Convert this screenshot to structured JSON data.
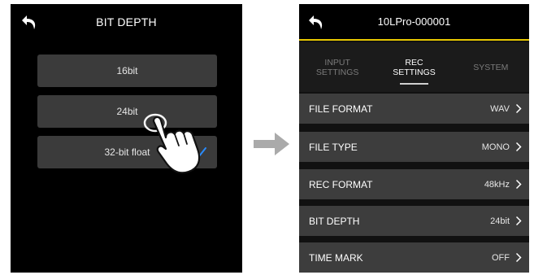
{
  "left_screen": {
    "title": "BIT DEPTH",
    "options": [
      {
        "label": "16bit"
      },
      {
        "label": "24bit"
      },
      {
        "label": "32-bit float"
      }
    ],
    "checked_option": "32-bit float"
  },
  "right_screen": {
    "title": "10LPro-000001",
    "tabs": [
      {
        "label": "INPUT\nSETTINGS",
        "active": false
      },
      {
        "label": "REC\nSETTINGS",
        "active": true
      },
      {
        "label": "SYSTEM",
        "active": false
      }
    ],
    "rows": [
      {
        "label": "FILE FORMAT",
        "value": "WAV"
      },
      {
        "label": "FILE TYPE",
        "value": "MONO"
      },
      {
        "label": "REC FORMAT",
        "value": "48kHz"
      },
      {
        "label": "BIT DEPTH",
        "value": "24bit"
      },
      {
        "label": "TIME MARK",
        "value": "OFF"
      }
    ]
  },
  "colors": {
    "accent_yellow": "#e6c700",
    "check_blue": "#2a8cff",
    "arrow_gray": "#aaaaaa"
  },
  "icons": [
    "back-arrow-icon",
    "checkmark-icon",
    "hand-tap-icon",
    "right-arrow-icon",
    "chevron-right-icon"
  ]
}
